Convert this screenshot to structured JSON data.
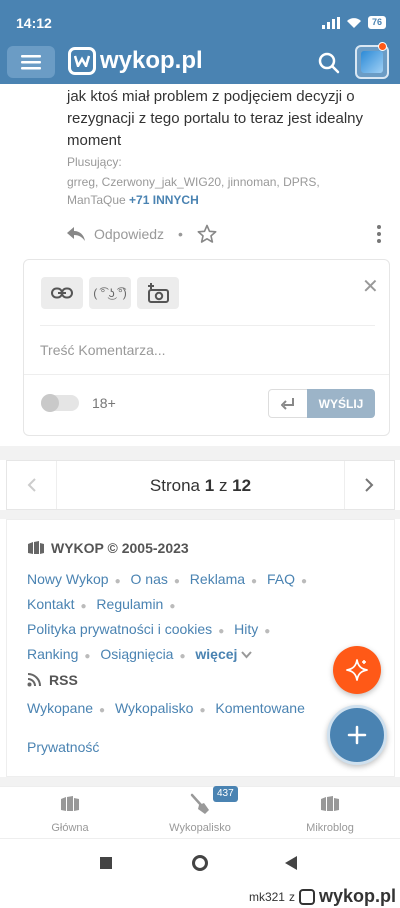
{
  "status_bar": {
    "time": "14:12",
    "battery": "76"
  },
  "header": {
    "logo_text": "wykop.pl"
  },
  "comment": {
    "text": "jak ktoś miał problem z podjęciem decyzji o rezygnacji z tego portalu to teraz jest idealny moment",
    "plusujacy_label": "Plusujący:",
    "plusujacy_users": "grreg, Czerwony_jak_WIG20, jinnoman, DPRS, ManTaQue",
    "plusujacy_more": "+71 INNYCH",
    "reply_label": "Odpowiedz",
    "dot": "•"
  },
  "form": {
    "lenny_label": "( ͡° ͜ʖ ͡°)",
    "placeholder": "Treść Komentarza...",
    "toggle_label": "18+",
    "send_label": "WYŚLIJ"
  },
  "pager": {
    "prefix": "Strona",
    "current": "1",
    "middle": "z",
    "total": "12"
  },
  "footer": {
    "brand": "WYKOP © 2005-2023",
    "links_row1": [
      "Nowy Wykop",
      "O nas",
      "Reklama",
      "FAQ"
    ],
    "links_row2": [
      "Kontakt",
      "Regulamin"
    ],
    "links_row3": [
      "Polityka prywatności i cookies",
      "Hity"
    ],
    "links_row4": [
      "Ranking",
      "Osiągnięcia"
    ],
    "more_label": "więcej",
    "rss_title": "RSS",
    "rss_links": [
      "Wykopane",
      "Wykopalisko",
      "Komentowane"
    ],
    "privacy": "Prywatność"
  },
  "tabs": [
    {
      "label": "Główna",
      "icon": "wykop-home-icon"
    },
    {
      "label": "Wykopalisko",
      "icon": "shovel-icon"
    },
    {
      "label": "Mikroblog",
      "icon": "mikroblog-icon"
    }
  ],
  "wykopalisko_badge": "437",
  "watermark": {
    "user": "mk321",
    "z": "z",
    "brand": "wykop.pl"
  },
  "colors": {
    "brand_blue": "#4a83b2",
    "accent_orange": "#ff5917"
  }
}
